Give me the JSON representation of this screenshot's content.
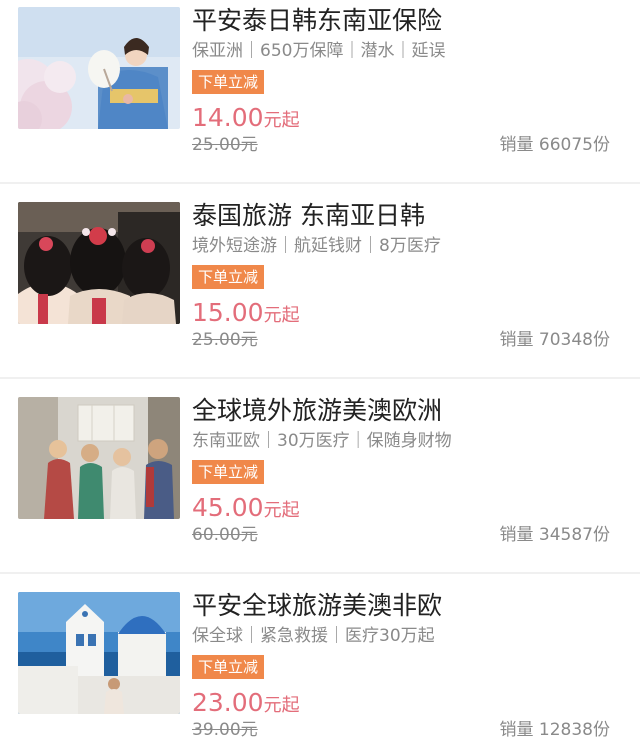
{
  "products": [
    {
      "title": "平安泰日韩东南亚保险",
      "tags": "保亚洲｜650万保障｜潜水｜延误",
      "badge": "下单立减",
      "price": "14.00",
      "price_unit": "元起",
      "original_price": "25.00元",
      "sales": "销量 66075份",
      "image": "kimono-woman-with-fan-cherry-blossoms"
    },
    {
      "title": "泰国旅游 东南亚日韩",
      "tags": "境外短途游｜航延钱财｜8万医疗",
      "badge": "下单立减",
      "price": "15.00",
      "price_unit": "元起",
      "original_price": "25.00元",
      "sales": "销量 70348份",
      "image": "geisha-hair-ornaments-back-view"
    },
    {
      "title": "全球境外旅游美澳欧洲",
      "tags": "东南亚欧｜30万医疗｜保随身财物",
      "badge": "下单立减",
      "price": "45.00",
      "price_unit": "元起",
      "original_price": "60.00元",
      "sales": "销量 34587份",
      "image": "tourists-with-map-street"
    },
    {
      "title": "平安全球旅游美澳非欧",
      "tags": "保全球｜紧急救援｜医疗30万起",
      "badge": "下单立减",
      "price": "23.00",
      "price_unit": "元起",
      "original_price": "39.00元",
      "sales": "销量 12838份",
      "image": "santorini-blue-dome-church"
    }
  ],
  "colors": {
    "price": "#e36d7a",
    "badge": "#f0884a",
    "title": "#222222",
    "muted": "#8a8a8a"
  }
}
